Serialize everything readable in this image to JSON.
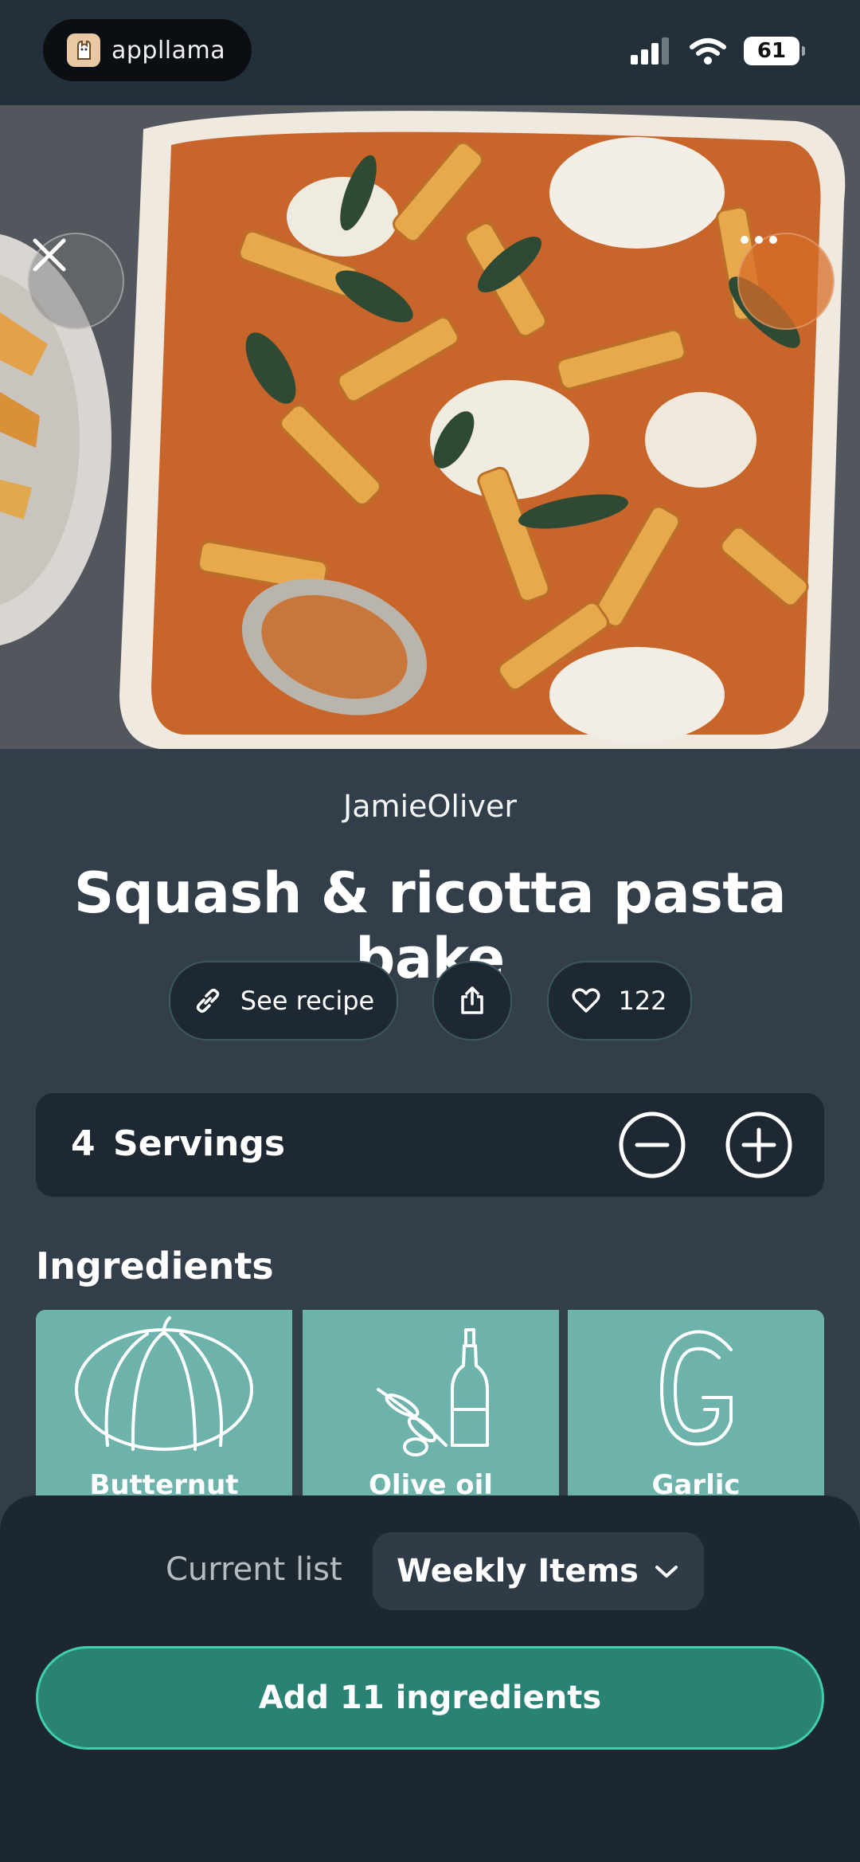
{
  "status_bar": {
    "app_name": "appllama",
    "battery": "61",
    "icons": [
      "cellular-icon",
      "wifi-icon",
      "battery-icon"
    ]
  },
  "hero": {
    "close_icon": "close-icon",
    "more_icon": "more-icon"
  },
  "recipe": {
    "source": "JamieOliver",
    "title": "Squash & ricotta pasta bake",
    "see_recipe_label": "See recipe",
    "likes": "122"
  },
  "servings": {
    "count": "4",
    "label": "Servings"
  },
  "ingredients": {
    "heading": "Ingredients",
    "items": [
      {
        "name": "Butternut squash",
        "icon": "pumpkin-icon"
      },
      {
        "name": "Olive oil",
        "icon": "olive-oil-icon"
      },
      {
        "name": "Garlic",
        "icon": "garlic-icon"
      }
    ]
  },
  "bottom_sheet": {
    "current_list_label": "Current list",
    "current_list_value": "Weekly Items",
    "add_button_label": "Add 11 ingredients"
  },
  "colors": {
    "background": "#323e49",
    "card": "#1d2832",
    "ingredient_tile": "#6db3ac",
    "accent": "#2a8275",
    "accent_border": "#3fcfae"
  }
}
